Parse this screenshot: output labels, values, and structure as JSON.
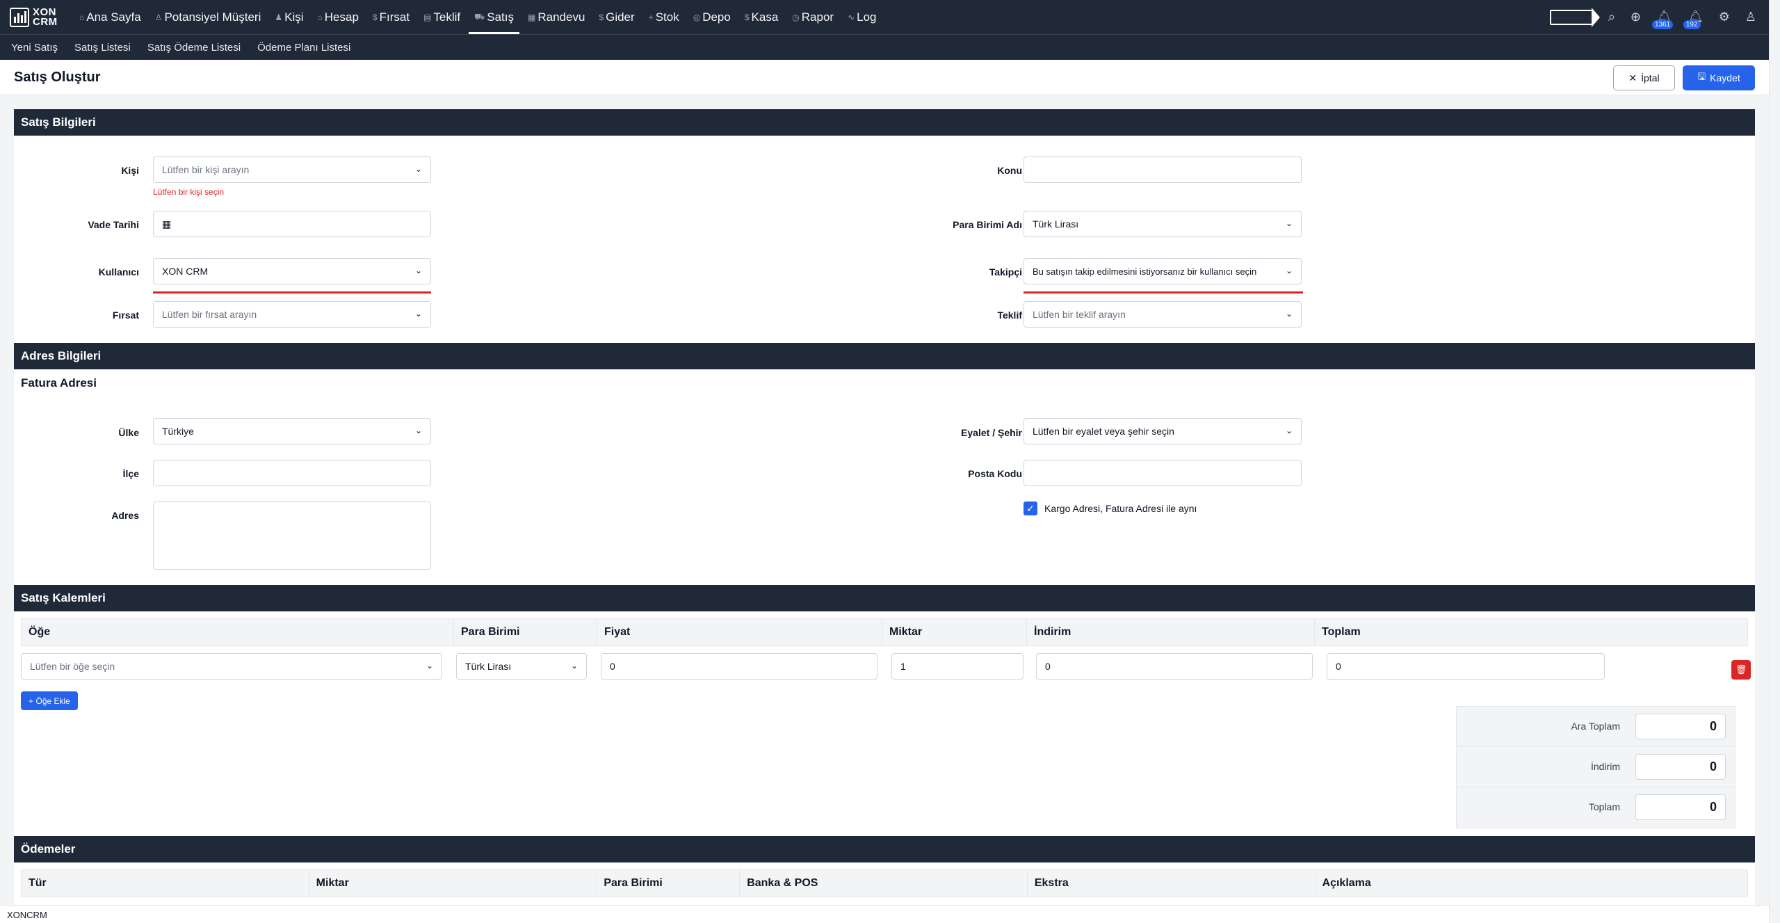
{
  "brand": {
    "line1": "XON",
    "line2": "CRM"
  },
  "nav": [
    {
      "label": "Ana Sayfa",
      "icon": "⌂",
      "icon_name": "home-icon"
    },
    {
      "label": "Potansiyel Müşteri",
      "icon": "♙",
      "icon_name": "lead-icon"
    },
    {
      "label": "Kişi",
      "icon": "♟",
      "icon_name": "people-icon"
    },
    {
      "label": "Hesap",
      "icon": "⌂",
      "icon_name": "account-icon"
    },
    {
      "label": "Fırsat",
      "icon": "$",
      "icon_name": "dollar-icon"
    },
    {
      "label": "Teklif",
      "icon": "▤",
      "icon_name": "document-icon"
    },
    {
      "label": "Satış",
      "icon": "⛟",
      "icon_name": "cart-icon"
    },
    {
      "label": "Randevu",
      "icon": "▦",
      "icon_name": "calendar-icon"
    },
    {
      "label": "Gider",
      "icon": "$",
      "icon_name": "expense-icon"
    },
    {
      "label": "Stok",
      "icon": "+",
      "icon_name": "stock-icon"
    },
    {
      "label": "Depo",
      "icon": "◎",
      "icon_name": "warehouse-icon"
    },
    {
      "label": "Kasa",
      "icon": "$",
      "icon_name": "cash-icon"
    },
    {
      "label": "Rapor",
      "icon": "◷",
      "icon_name": "report-icon"
    },
    {
      "label": "Log",
      "icon": "∿",
      "icon_name": "activity-icon"
    }
  ],
  "badges": {
    "first": "1361",
    "second": "192"
  },
  "subnav": [
    "Yeni Satış",
    "Satış Listesi",
    "Satış Ödeme Listesi",
    "Ödeme Planı Listesi"
  ],
  "page": {
    "title": "Satış Oluştur",
    "cancel": "İptal",
    "save": "Kaydet"
  },
  "sales_info": {
    "title": "Satış Bilgileri",
    "kisi_label": "Kişi",
    "kisi_placeholder": "Lütfen bir kişi arayın",
    "kisi_error": "Lütfen bir kişi seçin",
    "konu_label": "Konu",
    "vade_label": "Vade Tarihi",
    "para_label": "Para Birimi Adı",
    "para_value": "Türk Lirası",
    "kullanici_label": "Kullanıcı",
    "kullanici_value": "XON CRM",
    "takipci_label": "Takipçi",
    "takipci_value": "Bu satışın takip edilmesini istiyorsanız bir kullanıcı seçin",
    "firsat_label": "Fırsat",
    "firsat_placeholder": "Lütfen bir fırsat arayın",
    "teklif_label": "Teklif",
    "teklif_placeholder": "Lütfen bir teklif arayın"
  },
  "address": {
    "title": "Adres Bilgileri",
    "subtitle": "Fatura Adresi",
    "ulke_label": "Ülke",
    "ulke_value": "Türkiye",
    "eyalet_label": "Eyalet / Şehir",
    "eyalet_value": "Lütfen bir eyalet veya şehir seçin",
    "ilce_label": "İlçe",
    "posta_label": "Posta Kodu",
    "adres_label": "Adres",
    "kargo_label": "Kargo Adresi, Fatura Adresi ile aynı",
    "kargo_checked": true
  },
  "items": {
    "title": "Satış Kalemleri",
    "headers": [
      "Öğe",
      "Para Birimi",
      "Fiyat",
      "Miktar",
      "İndirim",
      "Toplam"
    ],
    "row": {
      "item_placeholder": "Lütfen bir öğe seçin",
      "currency": "Türk Lirası",
      "price": "0",
      "qty": "1",
      "discount": "0",
      "total": "0"
    },
    "add_button": "Öğe Ekle"
  },
  "totals": {
    "ara_label": "Ara Toplam",
    "ara_value": "0",
    "indirim_label": "İndirim",
    "indirim_value": "0",
    "toplam_label": "Toplam",
    "toplam_value": "0"
  },
  "payments": {
    "title": "Ödemeler",
    "headers": [
      "Tür",
      "Miktar",
      "Para Birimi",
      "Banka & POS",
      "Ekstra",
      "Açıklama"
    ]
  },
  "footer": "XONCRM",
  "colors": {
    "nav_bg": "#1f2937",
    "primary": "#2563eb",
    "danger": "#dc2626"
  }
}
